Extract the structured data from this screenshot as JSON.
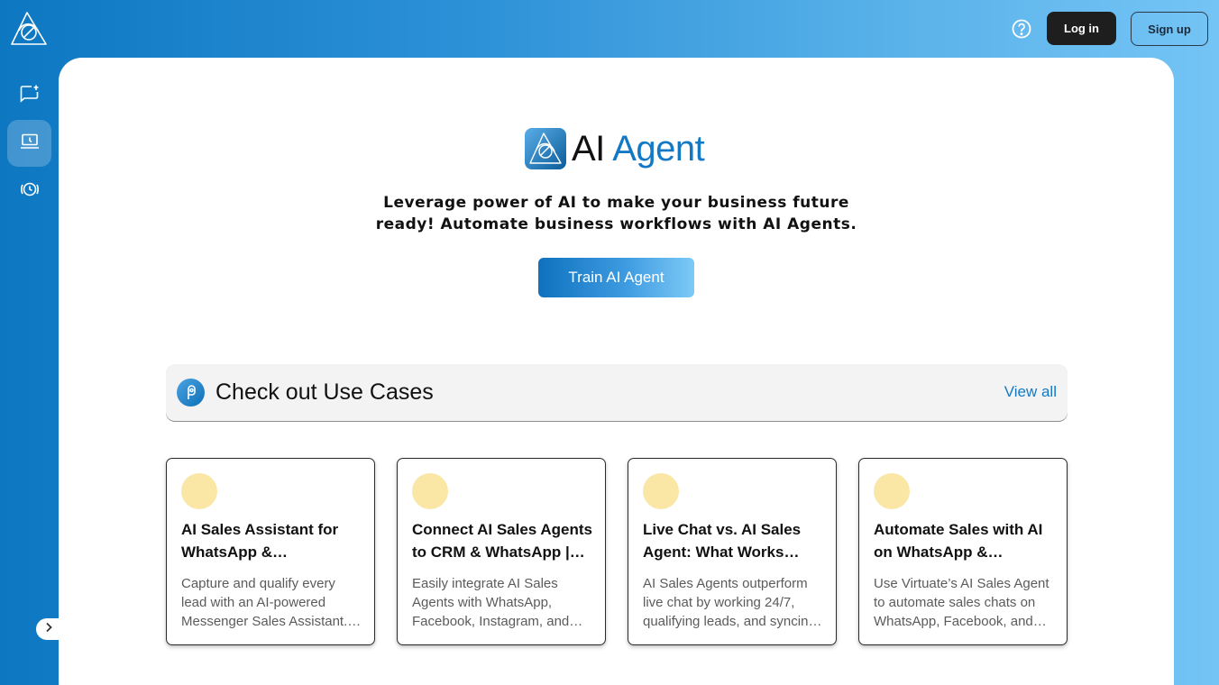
{
  "topbar": {
    "login_label": "Log in",
    "signup_label": "Sign up",
    "help_icon": "help-circle-icon"
  },
  "sidebar": {
    "logo_icon": "triangle-orbit-logo-icon",
    "items": [
      {
        "icon": "new-chat-icon",
        "active": false
      },
      {
        "icon": "laptop-icon",
        "active": true
      },
      {
        "icon": "history-icon",
        "active": false
      }
    ],
    "expand_icon": "chevron-right-icon"
  },
  "hero": {
    "brand_word1": "AI",
    "brand_word2": "Agent",
    "tagline_line1": "Leverage power of AI to make your business future",
    "tagline_line2": "ready! Automate business workflows with AI Agents.",
    "cta_label": "Train AI Agent"
  },
  "use_cases": {
    "title": "Check out Use Cases",
    "view_all": "View all",
    "cards": [
      {
        "title": "AI Sales Assistant for WhatsApp & Facebook…",
        "desc": "Capture and qualify every lead with an AI-powered Messenger Sales Assistant.…"
      },
      {
        "title": "Connect AI Sales Agents to CRM & WhatsApp |…",
        "desc": "Easily integrate AI Sales Agents with WhatsApp, Facebook, Instagram, and…"
      },
      {
        "title": "Live Chat vs. AI Sales Agent: What Works…",
        "desc": "AI Sales Agents outperform live chat by working 24/7, qualifying leads, and syncin…"
      },
      {
        "title": "Automate Sales with AI on WhatsApp &…",
        "desc": "Use Virtuate’s AI Sales Agent to automate sales chats on WhatsApp, Facebook, and…"
      }
    ]
  },
  "colors": {
    "accent": "#1479c4",
    "card_dot": "#fae7a5",
    "dark_button": "#1e1e1e"
  }
}
